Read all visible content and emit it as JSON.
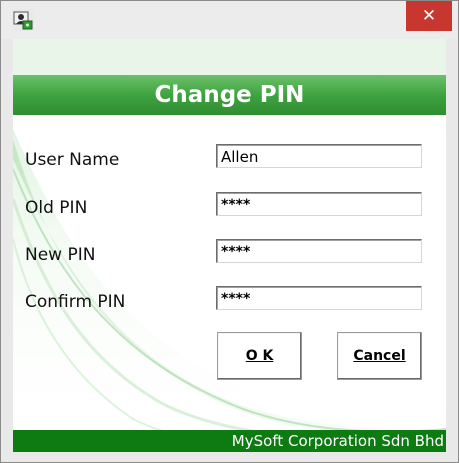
{
  "window": {
    "close_glyph": "✕"
  },
  "header": {
    "title": "Change PIN"
  },
  "form": {
    "fields": [
      {
        "label": "User Name",
        "value": "Allen"
      },
      {
        "label": "Old PIN",
        "value": "****"
      },
      {
        "label": "New PIN",
        "value": "****"
      },
      {
        "label": "Confirm PIN",
        "value": "****"
      }
    ]
  },
  "buttons": {
    "ok_label": "O K",
    "cancel_label": "Cancel"
  },
  "footer": {
    "company": "MySoft Corporation Sdn Bhd"
  },
  "colors": {
    "header_green": "#3fa340",
    "footer_green": "#0d7a12",
    "close_red": "#c7372f"
  },
  "icons": {
    "app": "user-key-icon",
    "close": "close-icon"
  }
}
